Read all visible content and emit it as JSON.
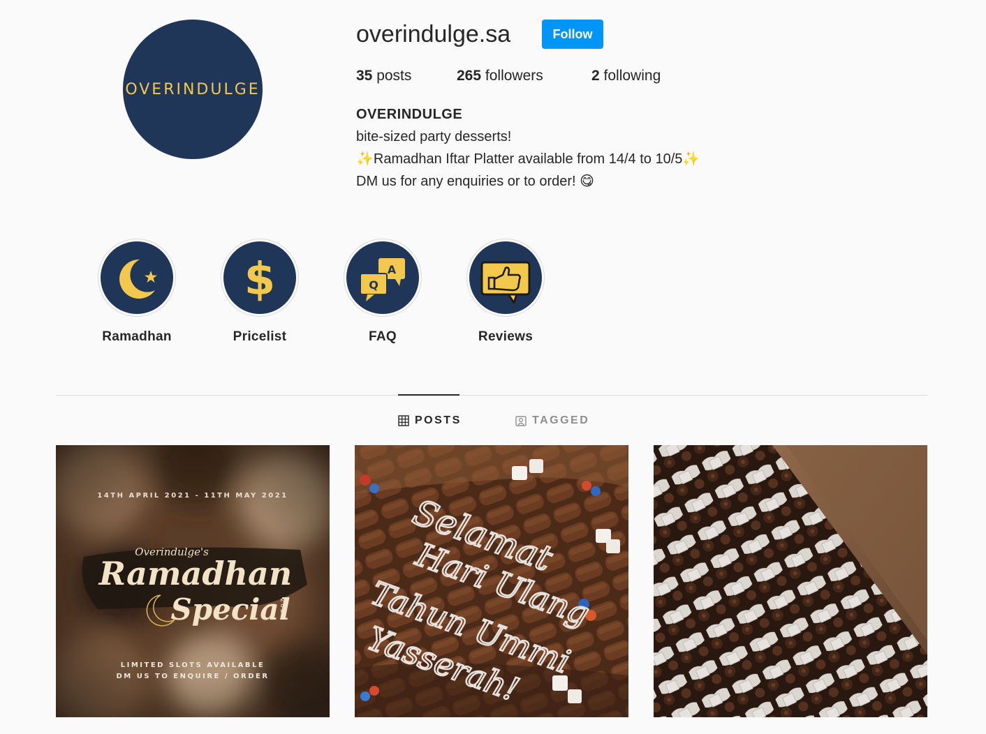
{
  "profile": {
    "username": "overindulge.sa",
    "follow_label": "Follow",
    "avatar_text": "OVERINDULGE",
    "stats": {
      "posts_count": "35",
      "posts_label": "posts",
      "followers_count": "265",
      "followers_label": "followers",
      "following_count": "2",
      "following_label": "following"
    },
    "bio": {
      "name": "OVERINDULGE",
      "line1": "bite-sized party desserts!",
      "line2": "Ramadhan Iftar Platter available from 14/4 to 10/5",
      "line3": "DM us for any enquiries or to order!",
      "sparkle": "✨",
      "emoji": "😋"
    }
  },
  "highlights": [
    {
      "label": "Ramadhan",
      "icon": "crescent-star-icon"
    },
    {
      "label": "Pricelist",
      "icon": "dollar-icon"
    },
    {
      "label": "FAQ",
      "icon": "qa-bubbles-icon"
    },
    {
      "label": "Reviews",
      "icon": "thumbs-up-icon"
    }
  ],
  "tabs": {
    "posts": "POSTS",
    "tagged": "TAGGED"
  },
  "posts": [
    {
      "date_range": "14TH APRIL 2021 - 11TH MAY 2021",
      "brand": "Overindulge's",
      "title1": "Ramadhan",
      "title2": "Special",
      "year": "2021",
      "footer1": "LIMITED SLOTS AVAILABLE",
      "footer2": "DM US TO ENQUIRE / ORDER"
    },
    {
      "line1": "Selamat",
      "line2": "Hari Ulang",
      "line3": "Tahun Ummi",
      "line4": "Yasserah!"
    },
    {}
  ],
  "colors": {
    "brand_navy": "#203658",
    "brand_yellow": "#f2c94c",
    "follow_blue": "#0095f6"
  }
}
